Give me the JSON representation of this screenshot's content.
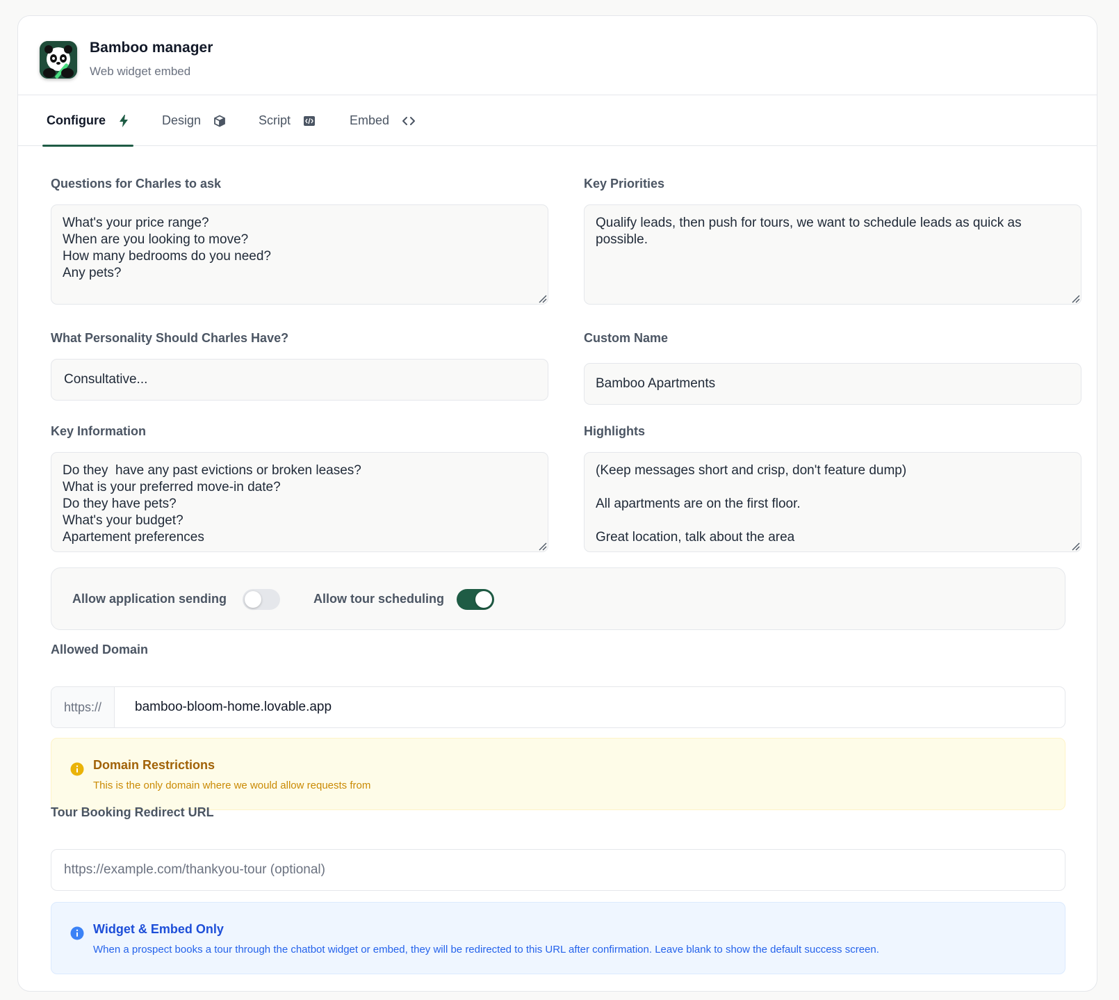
{
  "header": {
    "title": "Bamboo manager",
    "subtitle": "Web widget embed",
    "logo_icon": "panda-logo-icon"
  },
  "tabs": [
    {
      "label": "Configure",
      "icon": "lightning-icon",
      "active": true
    },
    {
      "label": "Design",
      "icon": "cube-icon",
      "active": false
    },
    {
      "label": "Script",
      "icon": "file-code-icon",
      "active": false
    },
    {
      "label": "Embed",
      "icon": "code-brackets-icon",
      "active": false
    }
  ],
  "form": {
    "questions": {
      "label": "Questions for Charles to ask",
      "value": "What's your price range?\nWhen are you looking to move?\nHow many bedrooms do you need?\nAny pets?"
    },
    "priorities": {
      "label": "Key Priorities",
      "value": "Qualify leads, then push for tours, we want to schedule leads as quick as possible."
    },
    "personality": {
      "label": "What Personality Should Charles Have?",
      "value": "Consultative..."
    },
    "custom_name": {
      "label": "Custom Name",
      "value": "Bamboo Apartments"
    },
    "key_information": {
      "label": "Key Information",
      "value": "Do they  have any past evictions or broken leases?\nWhat is your preferred move-in date?\nDo they have pets?\nWhat's your budget?\nApartement preferences"
    },
    "highlights": {
      "label": "Highlights",
      "value": "(Keep messages short and crisp, don't feature dump)\n\nAll apartments are on the first floor.\n\nGreat location, talk about the area"
    }
  },
  "toggles": {
    "application": {
      "label": "Allow application sending",
      "on": false
    },
    "tour": {
      "label": "Allow tour scheduling",
      "on": true
    }
  },
  "domain": {
    "label": "Allowed Domain",
    "prefix": "https://",
    "value": "bamboo-bloom-home.lovable.app"
  },
  "domain_notice": {
    "title": "Domain Restrictions",
    "body": "This is the only domain where we would allow requests from"
  },
  "redirect": {
    "label": "Tour Booking Redirect URL",
    "placeholder": "https://example.com/thankyou-tour (optional)"
  },
  "embed_notice": {
    "title": "Widget & Embed Only",
    "body": "When a prospect books a tour through the chatbot widget or embed, they will be redirected to this URL after confirmation. Leave blank to show the default success screen."
  },
  "colors": {
    "accent": "#1f5c45",
    "warn_bg": "#fefce8",
    "warn_text": "#a16207",
    "info_bg": "#eff6ff",
    "info_text": "#1d4ed8"
  }
}
